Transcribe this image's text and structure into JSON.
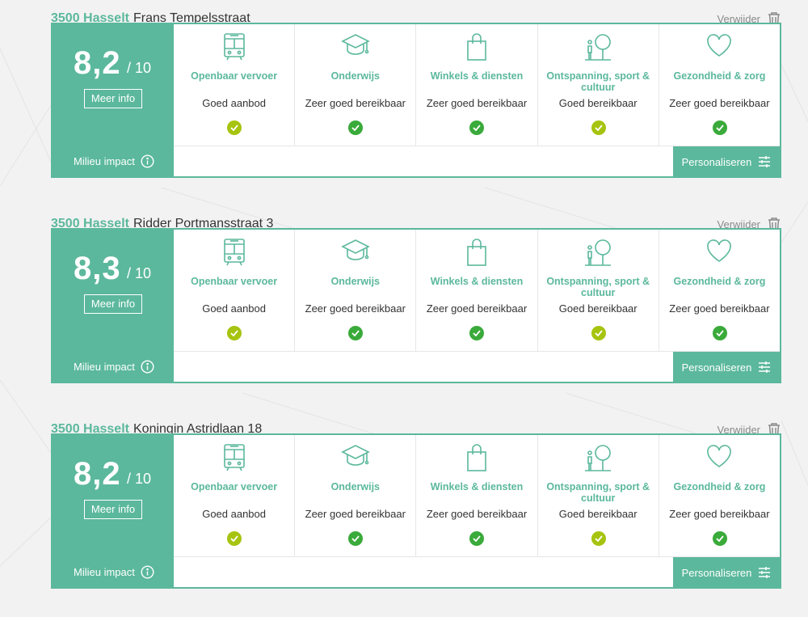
{
  "remove_label": "Verwijder",
  "more_info_label": "Meer info",
  "impact_label": "Milieu impact",
  "personalize_label": "Personaliseren",
  "score_max": "/ 10",
  "colors": {
    "accent": "#5bb89c",
    "check_lime": "#a6c40f",
    "check_green": "#3aaa3a"
  },
  "categories": [
    {
      "label": "Openbaar vervoer",
      "icon": "bus-icon"
    },
    {
      "label": "Onderwijs",
      "icon": "graduation-cap-icon"
    },
    {
      "label": "Winkels & diensten",
      "icon": "shopping-bag-icon"
    },
    {
      "label": "Ontspanning, sport & cultuur",
      "icon": "tree-person-icon"
    },
    {
      "label": "Gezondheid & zorg",
      "icon": "heart-icon"
    }
  ],
  "entries": [
    {
      "city": "3500 Hasselt",
      "street": "Frans Tempelsstraat",
      "score": "8,2",
      "values": [
        "Goed aanbod",
        "Zeer goed bereikbaar",
        "Zeer goed bereikbaar",
        "Goed bereikbaar",
        "Zeer goed bereikbaar"
      ],
      "checks": [
        "lime",
        "green",
        "green",
        "lime",
        "green"
      ]
    },
    {
      "city": "3500 Hasselt",
      "street": "Ridder Portmansstraat 3",
      "score": "8,3",
      "values": [
        "Goed aanbod",
        "Zeer goed bereikbaar",
        "Zeer goed bereikbaar",
        "Goed bereikbaar",
        "Zeer goed bereikbaar"
      ],
      "checks": [
        "lime",
        "green",
        "green",
        "lime",
        "green"
      ]
    },
    {
      "city": "3500 Hasselt",
      "street": "Koningin Astridlaan 18",
      "score": "8,2",
      "values": [
        "Goed aanbod",
        "Zeer goed bereikbaar",
        "Zeer goed bereikbaar",
        "Goed bereikbaar",
        "Zeer goed bereikbaar"
      ],
      "checks": [
        "lime",
        "green",
        "green",
        "lime",
        "green"
      ]
    }
  ]
}
